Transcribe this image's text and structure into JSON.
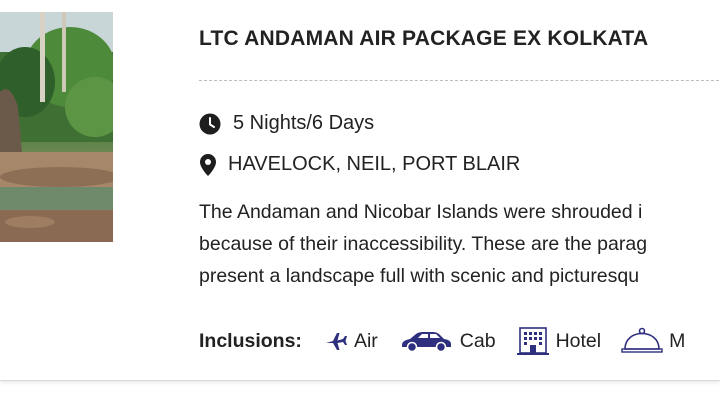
{
  "package": {
    "title": "LTC ANDAMAN AIR PACKAGE EX KOLKATA",
    "duration": "5 Nights/6 Days",
    "locations": "HAVELOCK, NEIL, PORT BLAIR",
    "description_lines": [
      "The Andaman and Nicobar Islands were shrouded i",
      "because of their inaccessibility. These are the parag",
      "present a landscape full with scenic and picturesqu"
    ],
    "image_alt": ""
  },
  "inclusions": {
    "label": "Inclusions:",
    "items": [
      {
        "label": "Air",
        "icon": "airplane-icon"
      },
      {
        "label": "Cab",
        "icon": "car-icon"
      },
      {
        "label": "Hotel",
        "icon": "hotel-icon"
      },
      {
        "label": "M",
        "icon": "meal-cloche-icon"
      }
    ]
  },
  "colors": {
    "icon_accent": "#2f2f7f",
    "text": "#222222",
    "divider": "#bdbdbd"
  }
}
